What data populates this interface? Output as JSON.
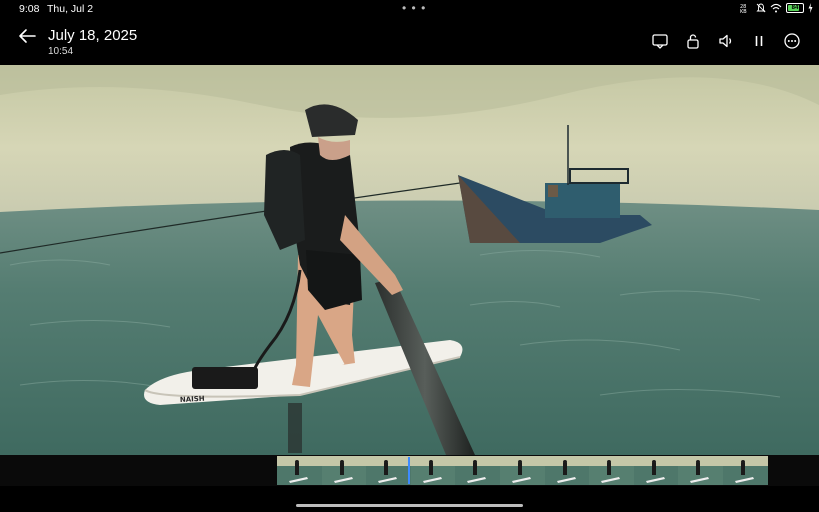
{
  "status_bar": {
    "time": "9:08",
    "date": "Thu, Jul 2",
    "icons": [
      "network-speed-icon",
      "mute-icon",
      "wifi-icon",
      "battery-icon",
      "charging-icon"
    ],
    "battery_level": "84"
  },
  "header": {
    "title": "July 18, 2025",
    "subtitle": "10:54",
    "actions": [
      "cast-icon",
      "unlock-icon",
      "volume-icon",
      "pause-icon",
      "more-icon"
    ]
  },
  "photo": {
    "board_brand": "NAISH"
  },
  "filmstrip": {
    "frame_count": 11,
    "playhead_fraction": 0.27
  },
  "colors": {
    "accent": "#3e8bff",
    "background": "#000000"
  }
}
